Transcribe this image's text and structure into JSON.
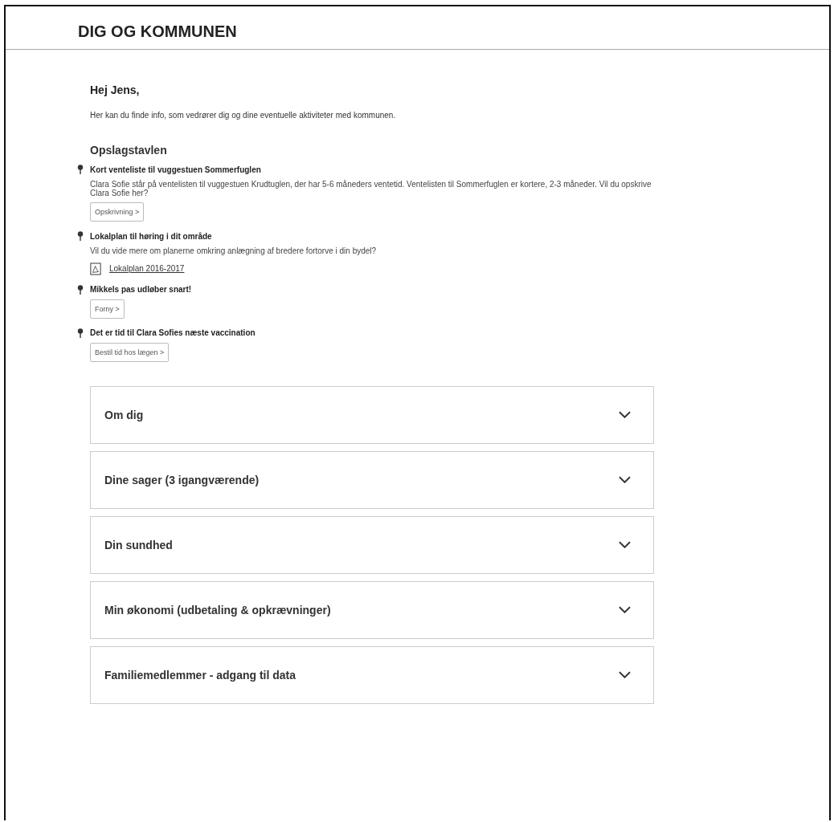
{
  "header": {
    "title": "DIG OG KOMMUNEN"
  },
  "greeting": "Hej Jens,",
  "intro": "Her kan du finde info, som vedrører dig og dine eventuelle aktiviteter med kommunen.",
  "board": {
    "title": "Opslagstavlen",
    "notices": [
      {
        "title": "Kort venteliste til vuggestuen Sommerfuglen",
        "text": "Clara Sofie står på ventelisten til vuggestuen Krudtuglen, der har 5-6 måneders ventetid. Ventelisten til Sommerfuglen er kortere, 2-3 måneder. Vil du opskrive Clara Sofie her?",
        "action": {
          "kind": "button",
          "label": "Opskrivning >"
        }
      },
      {
        "title": "Lokalplan til høring i dit område",
        "text": "Vil du vide mere om planerne omkring anlægning af bredere fortorve i din bydel?",
        "action": {
          "kind": "document",
          "label": "Lokalplan 2016-2017"
        }
      },
      {
        "title": "Mikkels pas udløber snart!",
        "action": {
          "kind": "button",
          "label": "Forny >"
        }
      },
      {
        "title": "Det er tid til Clara Sofies næste vaccination",
        "action": {
          "kind": "button",
          "label": "Bestil tid hos lægen >"
        }
      }
    ]
  },
  "sections": [
    {
      "title": "Om dig",
      "expanded": false
    },
    {
      "title": "Dine sager (3 igangværende)",
      "expanded": false
    },
    {
      "title": "Din sundhed",
      "expanded": false
    },
    {
      "title": "Min økonomi (udbetaling & opkrævninger)",
      "expanded": false
    },
    {
      "title": "Familiemedlemmer - adgang til data",
      "expanded": false
    }
  ]
}
